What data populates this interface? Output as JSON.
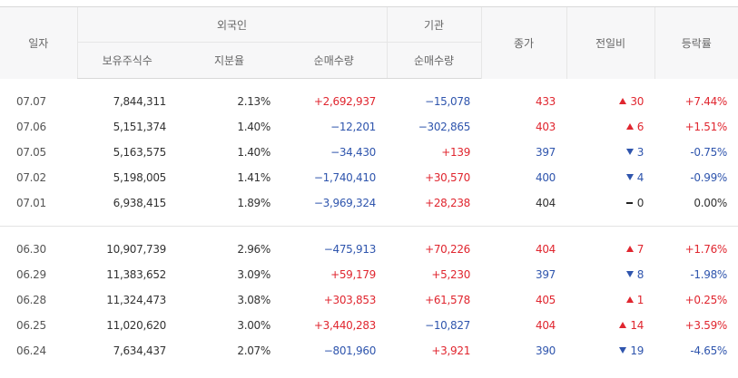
{
  "header": {
    "date": "일자",
    "foreign": "외국인",
    "institution": "기관",
    "close": "종가",
    "change": "전일비",
    "rate": "등락률",
    "holdings": "보유주식수",
    "share": "지분율",
    "foreign_net": "순매수량",
    "inst_net": "순매수량"
  },
  "colors": {
    "up": "#e0262f",
    "down": "#2f55ad",
    "neutral": "#333333"
  },
  "rows": [
    {
      "date": "07.07",
      "holdings": "7,844,311",
      "share": "2.13%",
      "foreign_net": "+2,692,937",
      "inst_net": "−15,078",
      "close": "433",
      "change": "30",
      "rate": "+7.44%",
      "dir": "up"
    },
    {
      "date": "07.06",
      "holdings": "5,151,374",
      "share": "1.40%",
      "foreign_net": "−12,201",
      "inst_net": "−302,865",
      "close": "403",
      "change": "6",
      "rate": "+1.51%",
      "dir": "up"
    },
    {
      "date": "07.05",
      "holdings": "5,163,575",
      "share": "1.40%",
      "foreign_net": "−34,430",
      "inst_net": "+139",
      "close": "397",
      "change": "3",
      "rate": "-0.75%",
      "dir": "down"
    },
    {
      "date": "07.02",
      "holdings": "5,198,005",
      "share": "1.41%",
      "foreign_net": "−1,740,410",
      "inst_net": "+30,570",
      "close": "400",
      "change": "4",
      "rate": "-0.99%",
      "dir": "down"
    },
    {
      "date": "07.01",
      "holdings": "6,938,415",
      "share": "1.89%",
      "foreign_net": "−3,969,324",
      "inst_net": "+28,238",
      "close": "404",
      "change": "0",
      "rate": "0.00%",
      "dir": "flat"
    },
    {
      "date": "06.30",
      "holdings": "10,907,739",
      "share": "2.96%",
      "foreign_net": "−475,913",
      "inst_net": "+70,226",
      "close": "404",
      "change": "7",
      "rate": "+1.76%",
      "dir": "up"
    },
    {
      "date": "06.29",
      "holdings": "11,383,652",
      "share": "3.09%",
      "foreign_net": "+59,179",
      "inst_net": "+5,230",
      "close": "397",
      "change": "8",
      "rate": "-1.98%",
      "dir": "down"
    },
    {
      "date": "06.28",
      "holdings": "11,324,473",
      "share": "3.08%",
      "foreign_net": "+303,853",
      "inst_net": "+61,578",
      "close": "405",
      "change": "1",
      "rate": "+0.25%",
      "dir": "up"
    },
    {
      "date": "06.25",
      "holdings": "11,020,620",
      "share": "3.00%",
      "foreign_net": "+3,440,283",
      "inst_net": "−10,827",
      "close": "404",
      "change": "14",
      "rate": "+3.59%",
      "dir": "up"
    },
    {
      "date": "06.24",
      "holdings": "7,634,437",
      "share": "2.07%",
      "foreign_net": "−801,960",
      "inst_net": "+3,921",
      "close": "390",
      "change": "19",
      "rate": "-4.65%",
      "dir": "down"
    }
  ]
}
